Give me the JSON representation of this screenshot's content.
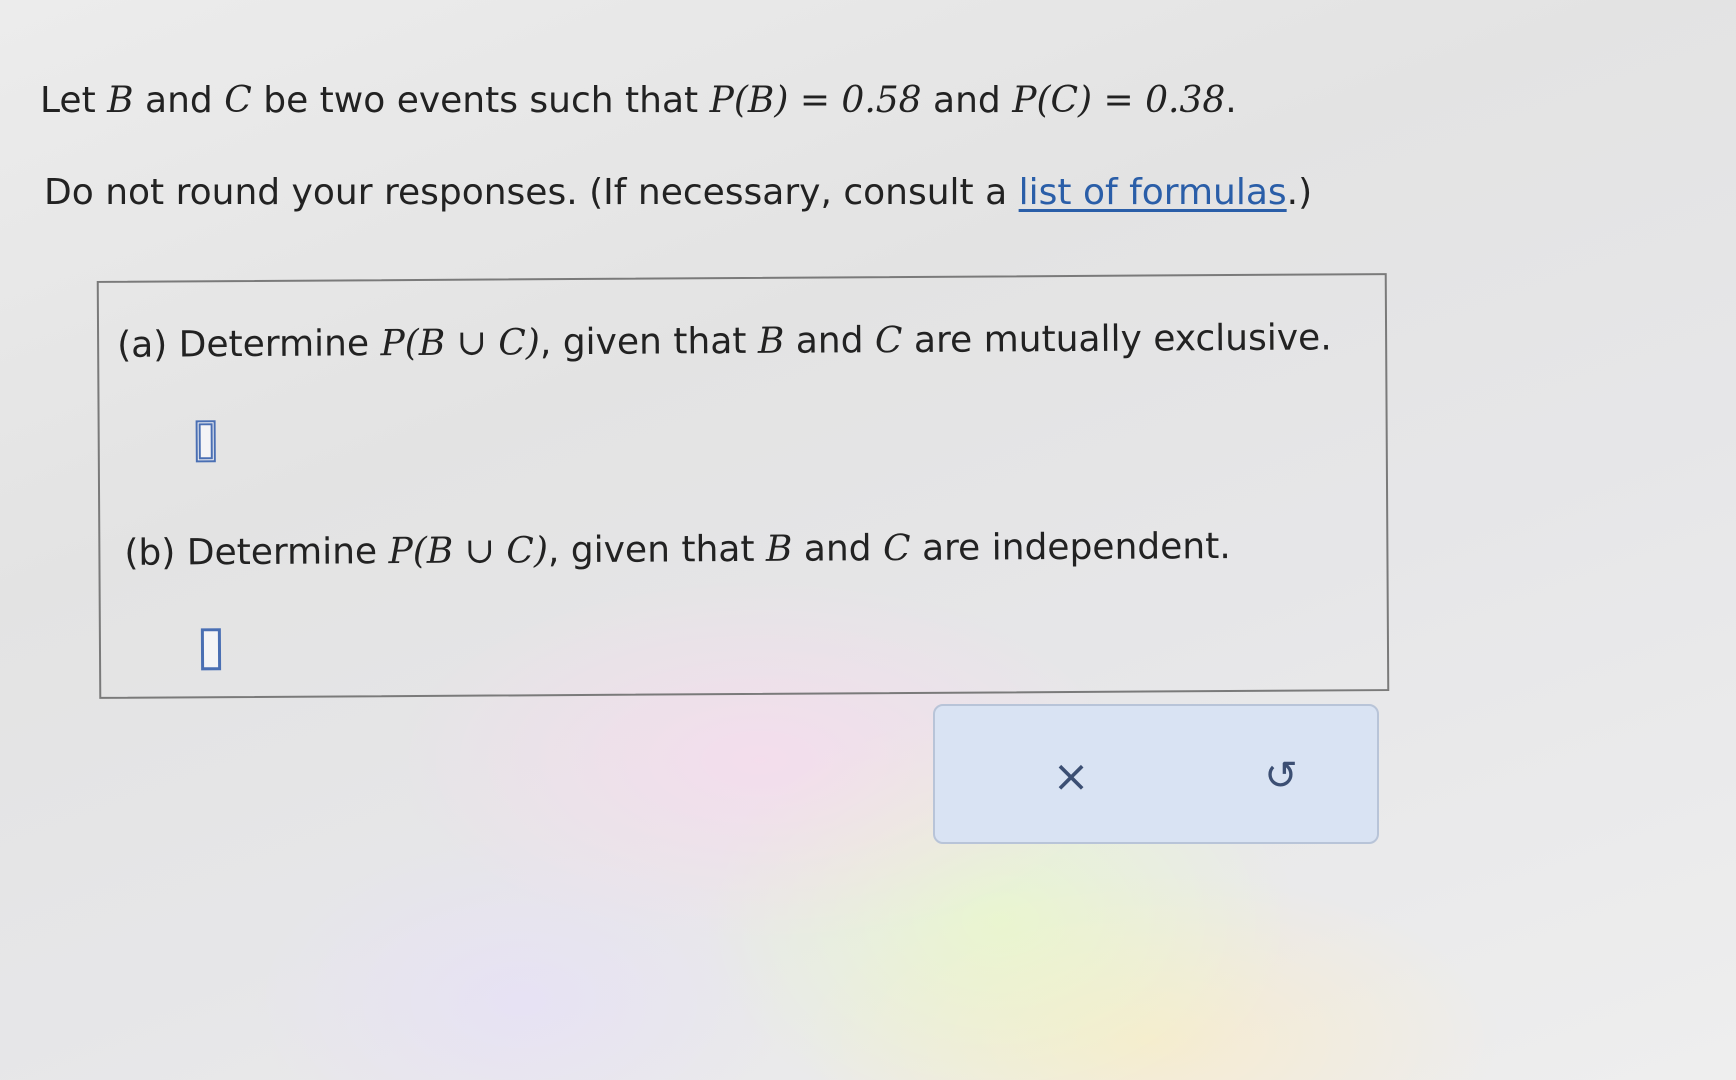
{
  "intro": {
    "prefix": "Let ",
    "var_b": "B",
    "and1": " and ",
    "var_c": "C",
    "middle": " be two events such that ",
    "pb_expr": "P(B) = 0.58",
    "and2": " and ",
    "pc_expr": "P(C) = 0.38",
    "period": "."
  },
  "instructions": {
    "text": "Do not round your responses. (If necessary, consult a ",
    "link": "list of formulas",
    "suffix": ".)"
  },
  "part_a": {
    "label": "(a) Determine ",
    "expr": "P(B ∪ C)",
    "text": ", given that ",
    "var_b": "B",
    "and": " and ",
    "var_c": "C",
    "end": " are mutually exclusive.",
    "value": ""
  },
  "part_b": {
    "label": "(b) Determine ",
    "expr": "P(B ∪ C)",
    "text": ", given that ",
    "var_b": "B",
    "and": " and ",
    "var_c": "C",
    "end": " are independent.",
    "value": ""
  },
  "actions": {
    "clear_icon": "×",
    "undo_icon": "↺",
    "clear_icon_name": "close-icon",
    "undo_icon_name": "undo-icon"
  }
}
